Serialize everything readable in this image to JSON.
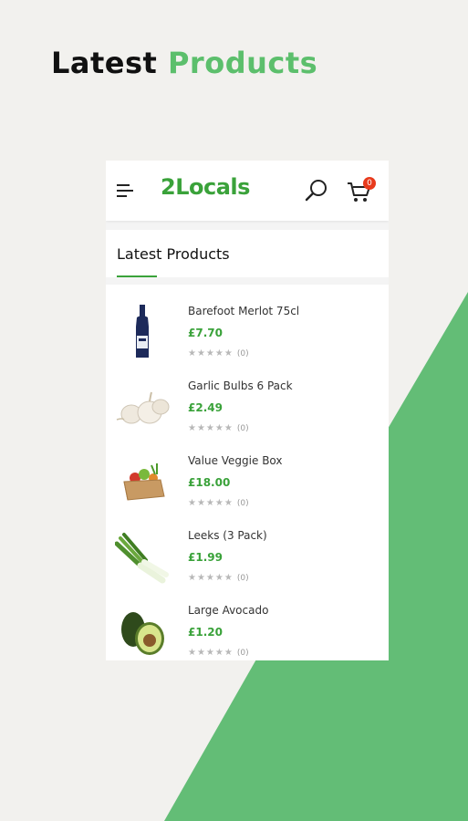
{
  "promo": {
    "title_part1": "Latest ",
    "title_part2": "Products",
    "accent_color": "#5cbf6c"
  },
  "header": {
    "brand": "2Locals",
    "cart_count": "0",
    "brand_color": "#3aa23a"
  },
  "section": {
    "label": "Latest Products"
  },
  "icons": {
    "menu": "menu-icon",
    "search": "search-icon",
    "cart": "cart-icon"
  },
  "products": [
    {
      "name": "Barefoot Merlot 75cl",
      "price": "£7.70",
      "stars": "★★★★★",
      "reviews": "(0)",
      "image": "wine-bottle"
    },
    {
      "name": "Garlic Bulbs 6 Pack",
      "price": "£2.49",
      "stars": "★★★★★",
      "reviews": "(0)",
      "image": "garlic"
    },
    {
      "name": "Value Veggie Box",
      "price": "£18.00",
      "stars": "★★★★★",
      "reviews": "(0)",
      "image": "veggie-box"
    },
    {
      "name": "Leeks (3 Pack)",
      "price": "£1.99",
      "stars": "★★★★★",
      "reviews": "(0)",
      "image": "leeks"
    },
    {
      "name": "Large Avocado",
      "price": "£1.20",
      "stars": "★★★★★",
      "reviews": "(0)",
      "image": "avocado"
    }
  ]
}
